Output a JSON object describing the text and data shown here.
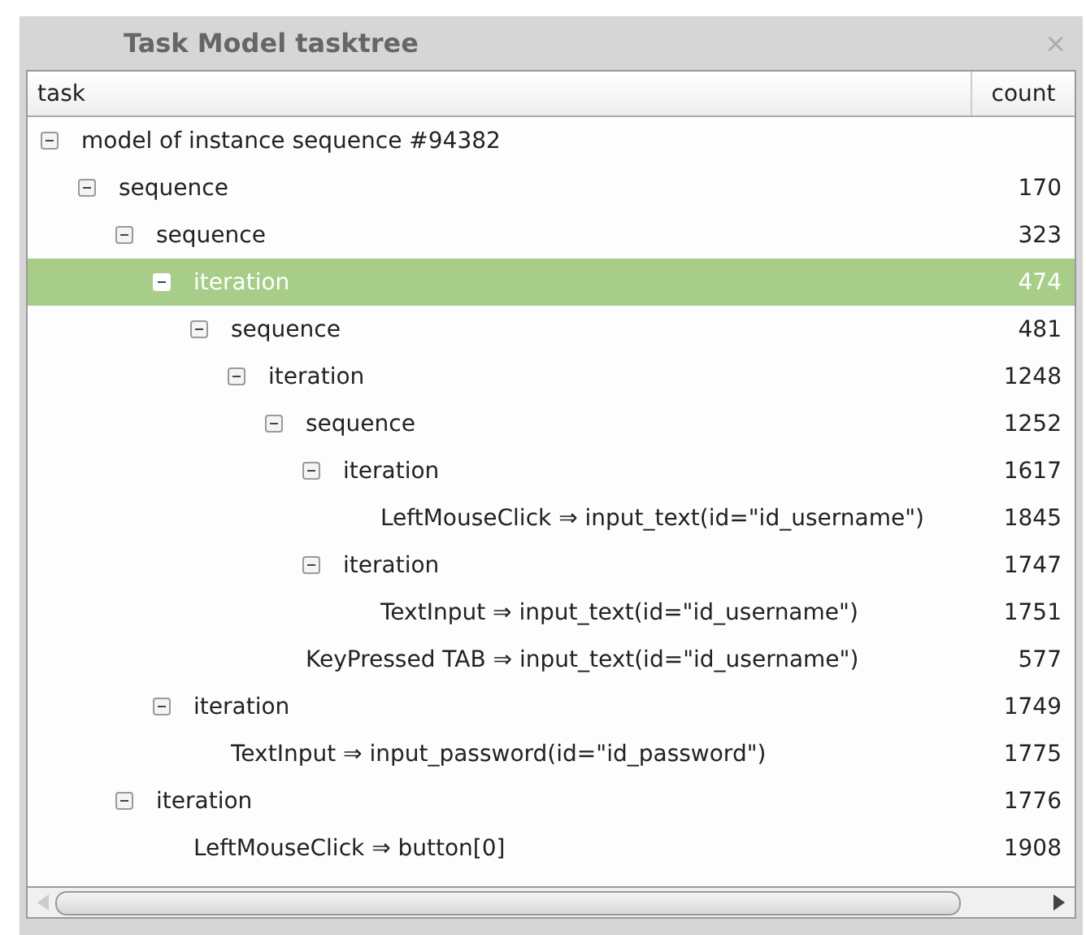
{
  "window": {
    "title": "Task Model tasktree",
    "close": "×"
  },
  "columns": [
    "task",
    "count"
  ],
  "tree": [
    {
      "label": "model of instance sequence #94382",
      "expanded": true,
      "selected": false,
      "children": [
        {
          "label": "sequence",
          "count": "170",
          "expanded": true,
          "selected": false,
          "children": [
            {
              "label": "sequence",
              "count": "323",
              "expanded": true,
              "selected": false,
              "children": [
                {
                  "label": "iteration",
                  "count": "474",
                  "expanded": true,
                  "selected": true,
                  "children": [
                    {
                      "label": "sequence",
                      "count": "481",
                      "expanded": true,
                      "selected": false,
                      "children": [
                        {
                          "label": "iteration",
                          "count": "1248",
                          "expanded": true,
                          "selected": false,
                          "children": [
                            {
                              "label": "sequence",
                              "count": "1252",
                              "expanded": true,
                              "selected": false,
                              "children": [
                                {
                                  "label": "iteration",
                                  "count": "1617",
                                  "expanded": true,
                                  "selected": false,
                                  "children": [
                                    {
                                      "label": "LeftMouseClick ⇒ input_text(id=\"id_username\")",
                                      "count": "1845",
                                      "selected": false
                                    }
                                  ]
                                },
                                {
                                  "label": "iteration",
                                  "count": "1747",
                                  "expanded": true,
                                  "selected": false,
                                  "children": [
                                    {
                                      "label": "TextInput ⇒ input_text(id=\"id_username\")",
                                      "count": "1751",
                                      "selected": false
                                    }
                                  ]
                                }
                              ]
                            },
                            {
                              "label": "KeyPressed TAB ⇒ input_text(id=\"id_username\")",
                              "count": "577",
                              "selected": false
                            }
                          ]
                        }
                      ]
                    }
                  ]
                },
                {
                  "label": "iteration",
                  "count": "1749",
                  "expanded": true,
                  "selected": false,
                  "children": [
                    {
                      "label": "TextInput ⇒ input_password(id=\"id_password\")",
                      "count": "1775",
                      "selected": false
                    }
                  ]
                }
              ]
            },
            {
              "label": "iteration",
              "count": "1776",
              "expanded": true,
              "selected": false,
              "children": [
                {
                  "label": "LeftMouseClick ⇒ button[0]",
                  "count": "1908",
                  "selected": false
                }
              ]
            }
          ]
        }
      ]
    }
  ]
}
